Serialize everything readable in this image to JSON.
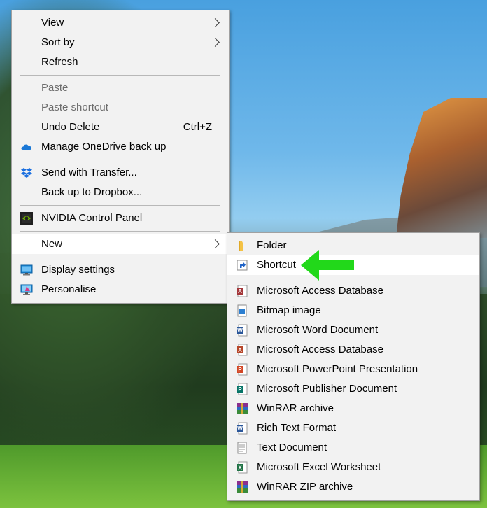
{
  "main_menu": {
    "items": [
      {
        "label": "View",
        "submenu": true
      },
      {
        "label": "Sort by",
        "submenu": true
      },
      {
        "label": "Refresh"
      },
      {
        "label": "Paste",
        "disabled": true
      },
      {
        "label": "Paste shortcut",
        "disabled": true
      },
      {
        "label": "Undo Delete",
        "shortcut": "Ctrl+Z"
      },
      {
        "label": "Manage OneDrive back up",
        "icon": "onedrive-cloud-icon"
      },
      {
        "label": "Send with Transfer...",
        "icon": "dropbox-icon"
      },
      {
        "label": "Back up to Dropbox..."
      },
      {
        "label": "NVIDIA Control Panel",
        "icon": "nvidia-icon"
      },
      {
        "label": "New",
        "submenu": true,
        "active": true
      },
      {
        "label": "Display settings",
        "icon": "display-settings-icon"
      },
      {
        "label": "Personalise",
        "icon": "personalise-icon"
      }
    ]
  },
  "new_submenu": {
    "items": [
      {
        "label": "Folder",
        "icon": "folder-icon"
      },
      {
        "label": "Shortcut",
        "icon": "shortcut-icon"
      },
      {
        "label": "Microsoft Access Database",
        "icon": "access-icon"
      },
      {
        "label": "Bitmap image",
        "icon": "bitmap-icon"
      },
      {
        "label": "Microsoft Word Document",
        "icon": "word-icon"
      },
      {
        "label": "Microsoft Access Database",
        "icon": "access-icon"
      },
      {
        "label": "Microsoft PowerPoint Presentation",
        "icon": "powerpoint-icon"
      },
      {
        "label": "Microsoft Publisher Document",
        "icon": "publisher-icon"
      },
      {
        "label": "WinRAR archive",
        "icon": "winrar-icon"
      },
      {
        "label": "Rich Text Format",
        "icon": "rtf-icon"
      },
      {
        "label": "Text Document",
        "icon": "text-document-icon"
      },
      {
        "label": "Microsoft Excel Worksheet",
        "icon": "excel-icon"
      },
      {
        "label": "WinRAR ZIP archive",
        "icon": "winrar-zip-icon"
      }
    ]
  },
  "colors": {
    "menu_bg": "#f2f2f2",
    "highlight_bg": "#ffffff",
    "arrow_green": "#22d81a"
  }
}
